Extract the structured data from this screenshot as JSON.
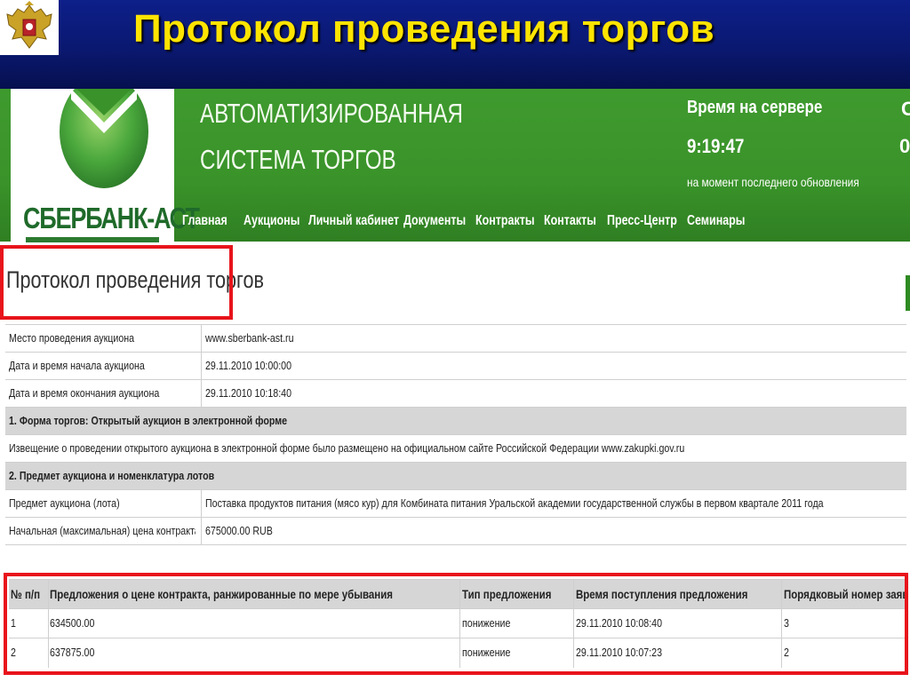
{
  "slide": {
    "title": "Протокол проведения торгов",
    "emblem_icon": "coat-of-arms-icon"
  },
  "site": {
    "logo_text": "СБЕРБАНК-АСТ",
    "system_title_line1": "АВТОМАТИЗИРОВАННАЯ",
    "system_title_line2": "СИСТЕМА ТОРГОВ",
    "server_time_label": "Время на сервере",
    "server_time": "9:19:47",
    "server_time_note": "на момент последнего обновления",
    "clipped_label": "С",
    "clipped_value": "0",
    "nav": [
      "Главная",
      "Аукционы",
      "Личный кабинет",
      "Документы",
      "Контракты",
      "Контакты",
      "Пресс-Центр",
      "Семинары"
    ],
    "colors": {
      "header_green": "#3a932a",
      "highlight_red": "#e8141b",
      "title_yellow": "#ffe400",
      "slide_blue": "#0a1870"
    }
  },
  "protocol": {
    "heading": "Протокол проведения торгов",
    "info_rows": [
      {
        "label": "Место проведения аукциона",
        "value": "www.sberbank-ast.ru"
      },
      {
        "label": "Дата и время начала аукциона",
        "value": "29.11.2010 10:00:00"
      },
      {
        "label": "Дата и время окончания аукциона",
        "value": "29.11.2010 10:18:40"
      }
    ],
    "section1": "1. Форма торгов: Открытый аукцион в электронной форме",
    "notice": "Извещение о проведении открытого аукциона в электронной форме было размещено на официальном сайте Российской Федерации www.zakupki.gov.ru",
    "section2": "2. Предмет аукциона и номенклатура лотов",
    "lot_rows": [
      {
        "label": "Предмет аукциона (лота)",
        "value": "Поставка продуктов питания (мясо кур) для Комбината питания Уральской академии государственной службы в первом квартале 2011 года"
      },
      {
        "label": "Начальная (максимальная) цена контракта",
        "value": "675000.00 RUB"
      }
    ]
  },
  "bids": {
    "headers": [
      "№ п/п",
      "Предложения о цене контракта, ранжированные по мере убывания",
      "Тип предложения",
      "Время поступления предложения",
      "Порядковый номер заявки"
    ],
    "rows": [
      [
        "1",
        "634500.00",
        "понижение",
        "29.11.2010 10:08:40",
        "3"
      ],
      [
        "2",
        "637875.00",
        "понижение",
        "29.11.2010 10:07:23",
        "2"
      ]
    ]
  }
}
